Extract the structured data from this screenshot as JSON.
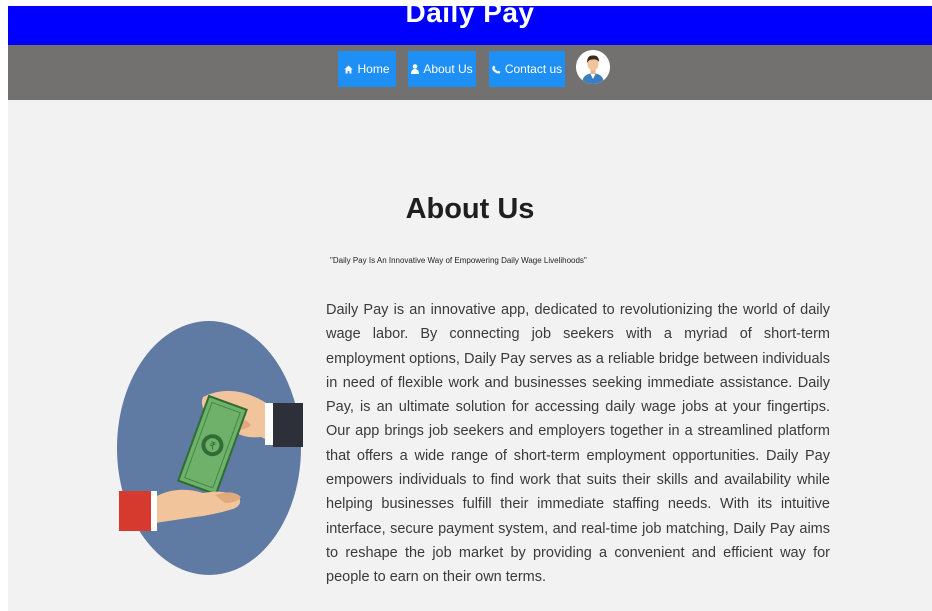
{
  "header": {
    "brand": "Daily Pay",
    "brand_bg": "#0000ff",
    "nav_bg": "#737070",
    "button_bg": "#1e90f5"
  },
  "nav": {
    "items": [
      {
        "label": "Home",
        "icon": "home-icon"
      },
      {
        "label": "About Us",
        "icon": "user-icon"
      },
      {
        "label": "Contact us",
        "icon": "phone-icon"
      }
    ],
    "avatar_icon": "user-avatar"
  },
  "main": {
    "title": "About Us",
    "tagline": "\"Daily Pay Is An Innovative Way of Empowering Daily Wage Livelihoods\"",
    "illustration": "hand-giving-money-illustration",
    "description": "Daily Pay is an innovative app, dedicated to revolutionizing the world of daily wage labor. By connecting job seekers with a myriad of short-term employment options, Daily Pay serves as a reliable bridge between individuals in need of flexible work and businesses seeking immediate assistance. Daily Pay, is an ultimate solution for accessing daily wage jobs at your fingertips. Our app brings job seekers and employers together in a streamlined platform that offers a wide range of short-term employment opportunities. Daily Pay empowers individuals to find work that suits their skills and availability while helping businesses fulfill their immediate staffing needs. With its intuitive interface, secure payment system, and real-time job matching, Daily Pay aims to reshape the job market by providing a convenient and efficient way for people to earn on their own terms."
  }
}
